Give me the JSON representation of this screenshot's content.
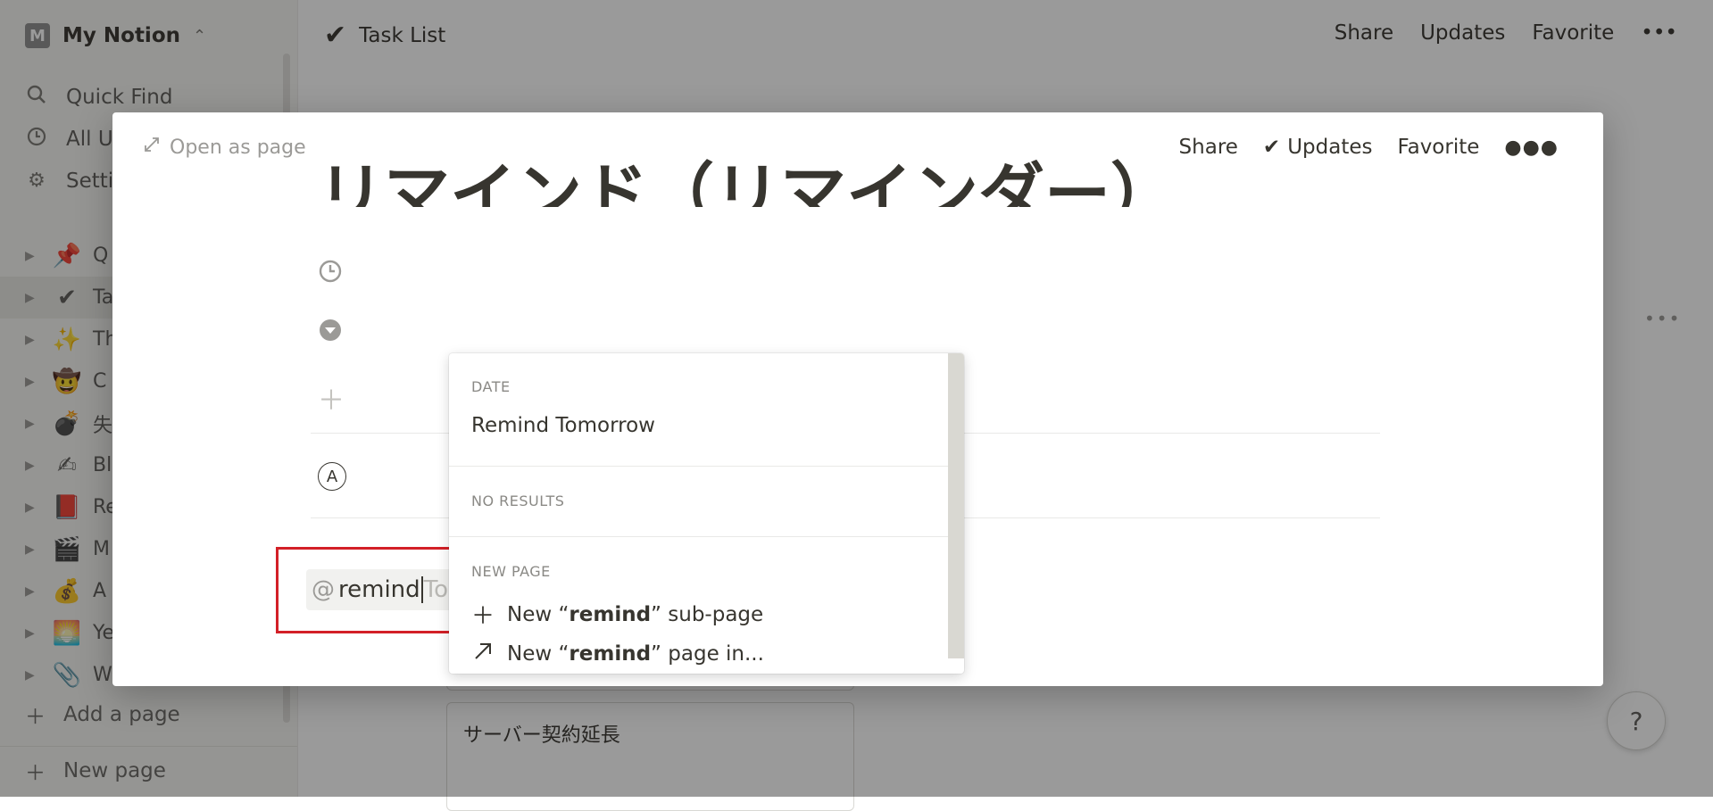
{
  "sidebar": {
    "workspace_initial": "M",
    "workspace_name": "My Notion",
    "top_items": [
      {
        "icon": "search-icon",
        "label": "Quick Find"
      },
      {
        "icon": "clock-icon",
        "label": "All U"
      },
      {
        "icon": "gear-icon",
        "label": "Setti"
      }
    ],
    "pages": [
      {
        "emoji": "📌",
        "label": "Q"
      },
      {
        "emoji": "✔",
        "label": "Ta"
      },
      {
        "emoji": "✨",
        "label": "Th"
      },
      {
        "emoji": "🤠",
        "label": "C"
      },
      {
        "emoji": "💣",
        "label": "失"
      },
      {
        "emoji": "✍",
        "label": "Bl"
      },
      {
        "emoji": "📕",
        "label": "Re"
      },
      {
        "emoji": "🎬",
        "label": "M"
      },
      {
        "emoji": "💰",
        "label": "A"
      },
      {
        "emoji": "🌅",
        "label": "Ye"
      },
      {
        "emoji": "📎",
        "label": "W"
      }
    ],
    "add_page": "Add a page",
    "new_page": "New page"
  },
  "topbar": {
    "breadcrumb": "Task List",
    "share": "Share",
    "updates": "Updates",
    "favorite": "Favorite"
  },
  "background": {
    "card_title": "サーバー契約延長"
  },
  "modal": {
    "open_as_page": "Open as page",
    "share": "Share",
    "updates": "Updates",
    "favorite": "Favorite",
    "page_title": "リマインド（リマインダー）",
    "property_initial": "A"
  },
  "mention": {
    "at": "@",
    "typed": "remind",
    "suggestion": "Tomorrow"
  },
  "dropdown": {
    "section_date": "DATE",
    "remind_tomorrow": "Remind Tomorrow",
    "section_no_results": "NO RESULTS",
    "section_new_page": "NEW PAGE",
    "new_subpage_prefix": "New “",
    "new_subpage_bold": "remind",
    "new_subpage_suffix": "” sub-page",
    "new_pagein_prefix": "New “",
    "new_pagein_bold": "remind",
    "new_pagein_suffix": "” page in..."
  },
  "help": "?"
}
